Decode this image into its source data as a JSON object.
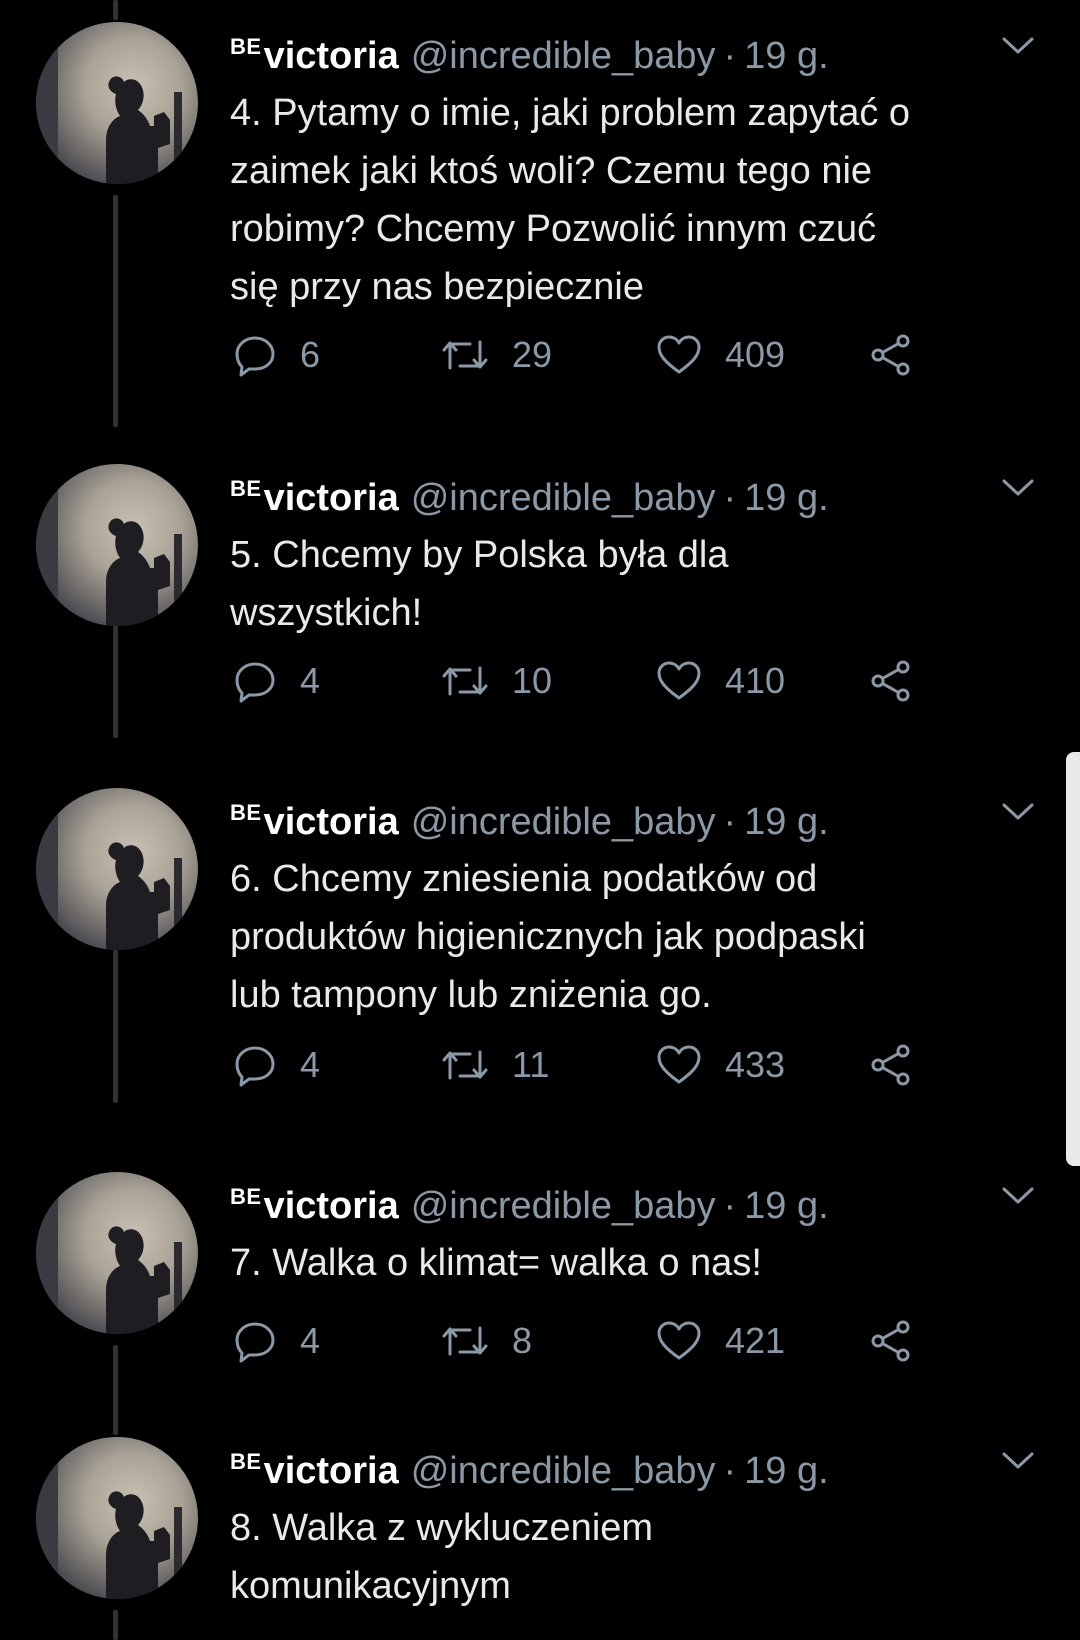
{
  "tweets": [
    {
      "badge": "BE",
      "name": "victoria",
      "handle": "@incredible_baby",
      "separator": "·",
      "time": "19 g.",
      "lines": [
        "4. Pytamy o imie, jaki problem zapytać o",
        "zaimek jaki ktoś woli? Czemu tego nie",
        "robimy? Chcemy Pozwolić innym czuć",
        "się przy nas bezpiecznie"
      ],
      "replies": "6",
      "retweets": "29",
      "likes": "409"
    },
    {
      "badge": "BE",
      "name": "victoria",
      "handle": "@incredible_baby",
      "separator": "·",
      "time": "19 g.",
      "lines": [
        "5. Chcemy by Polska była dla",
        "wszystkich!"
      ],
      "replies": "4",
      "retweets": "10",
      "likes": "410"
    },
    {
      "badge": "BE",
      "name": "victoria",
      "handle": "@incredible_baby",
      "separator": "·",
      "time": "19 g.",
      "lines": [
        "6. Chcemy zniesienia podatków od",
        "produktów higienicznych jak podpaski",
        "lub tampony lub zniżenia go."
      ],
      "replies": "4",
      "retweets": "11",
      "likes": "433"
    },
    {
      "badge": "BE",
      "name": "victoria",
      "handle": "@incredible_baby",
      "separator": "·",
      "time": "19 g.",
      "lines": [
        "7. Walka o klimat= walka o nas!"
      ],
      "replies": "4",
      "retweets": "8",
      "likes": "421"
    },
    {
      "badge": "BE",
      "name": "victoria",
      "handle": "@incredible_baby",
      "separator": "·",
      "time": "19 g.",
      "lines": [
        "8. Walka z wykluczeniem",
        "komunikacyjnym"
      ]
    }
  ],
  "icons": {
    "reply": "reply-icon",
    "retweet": "retweet-icon",
    "like": "heart-icon",
    "share": "share-icon",
    "menu": "chevron-down-icon"
  },
  "colors": {
    "background": "#000000",
    "primary_text": "#e7e9ea",
    "secondary_text": "#8b98a5",
    "thread_line": "#2f3336"
  }
}
